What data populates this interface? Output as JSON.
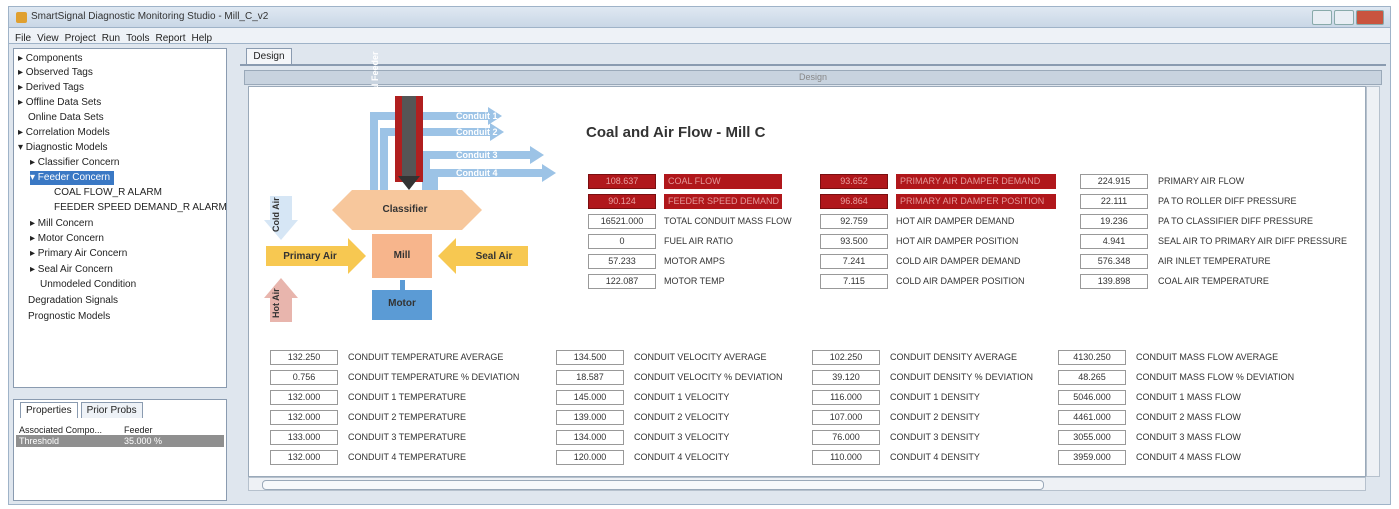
{
  "window": {
    "title": "SmartSignal Diagnostic Monitoring Studio - Mill_C_v2"
  },
  "menu": [
    "File",
    "View",
    "Project",
    "Run",
    "Tools",
    "Report",
    "Help"
  ],
  "tree": {
    "items": [
      {
        "label": "▸ Components"
      },
      {
        "label": "▸ Observed Tags"
      },
      {
        "label": "▸ Derived Tags"
      },
      {
        "label": "▸ Offline Data Sets"
      },
      {
        "label": "Online Data Sets"
      },
      {
        "label": "▸ Correlation Models"
      },
      {
        "label": "▾ Diagnostic Models"
      },
      {
        "label": "▸ Classifier Concern"
      },
      {
        "label": "▾ Feeder Concern"
      },
      {
        "label": "COAL FLOW_R ALARM"
      },
      {
        "label": "FEEDER SPEED DEMAND_R ALARM"
      },
      {
        "label": "▸ Mill Concern"
      },
      {
        "label": "▸ Motor Concern"
      },
      {
        "label": "▸ Primary Air Concern"
      },
      {
        "label": "▸ Seal Air Concern"
      },
      {
        "label": "Unmodeled Condition"
      },
      {
        "label": "Degradation Signals"
      },
      {
        "label": "Prognostic Models"
      }
    ]
  },
  "properties": {
    "tabs": [
      "Properties",
      "Prior Probs"
    ],
    "rows": [
      {
        "key": "Associated Compo...",
        "value": "Feeder"
      },
      {
        "key": "Threshold",
        "value": "35.000 %"
      }
    ]
  },
  "design": {
    "tab_label": "Design",
    "inner_title": "Design",
    "heading": "Coal and Air Flow - Mill C",
    "diagram": {
      "conduits": [
        "Conduit 1",
        "Conduit 2",
        "Conduit 3",
        "Conduit 4"
      ],
      "coal_feeder": "Coal Feeder",
      "classifier": "Classifier",
      "mill": "Mill",
      "motor": "Motor",
      "primary_air": "Primary Air",
      "seal_air": "Seal Air",
      "cold_air": "Cold Air",
      "hot_air": "Hot Air"
    },
    "top_col1": [
      {
        "value": "108.637",
        "label": "COAL FLOW",
        "alarm": true
      },
      {
        "value": "90.124",
        "label": "FEEDER SPEED DEMAND",
        "alarm": true
      },
      {
        "value": "16521.000",
        "label": "TOTAL CONDUIT MASS FLOW",
        "alarm": false
      },
      {
        "value": "0",
        "label": "FUEL AIR RATIO",
        "alarm": false
      },
      {
        "value": "57.233",
        "label": "MOTOR AMPS",
        "alarm": false
      },
      {
        "value": "122.087",
        "label": "MOTOR TEMP",
        "alarm": false
      }
    ],
    "top_col2": [
      {
        "value": "93.652",
        "label": "PRIMARY AIR DAMPER DEMAND",
        "alarm": true
      },
      {
        "value": "96.864",
        "label": "PRIMARY AIR DAMPER POSITION",
        "alarm": true
      },
      {
        "value": "92.759",
        "label": "HOT AIR DAMPER DEMAND",
        "alarm": false
      },
      {
        "value": "93.500",
        "label": "HOT AIR DAMPER POSITION",
        "alarm": false
      },
      {
        "value": "7.241",
        "label": "COLD AIR DAMPER DEMAND",
        "alarm": false
      },
      {
        "value": "7.115",
        "label": "COLD AIR DAMPER POSITION",
        "alarm": false
      }
    ],
    "top_col3": [
      {
        "value": "224.915",
        "label": "PRIMARY AIR FLOW"
      },
      {
        "value": "22.111",
        "label": "PA TO ROLLER DIFF PRESSURE"
      },
      {
        "value": "19.236",
        "label": "PA TO CLASSIFIER DIFF PRESSURE"
      },
      {
        "value": "4.941",
        "label": "SEAL AIR TO PRIMARY AIR DIFF PRESSURE"
      },
      {
        "value": "576.348",
        "label": "AIR INLET TEMPERATURE"
      },
      {
        "value": "139.898",
        "label": "COAL AIR TEMPERATURE"
      }
    ],
    "bottom_col1": [
      {
        "value": "132.250",
        "label": "CONDUIT TEMPERATURE AVERAGE"
      },
      {
        "value": "0.756",
        "label": "CONDUIT TEMPERATURE % DEVIATION"
      },
      {
        "value": "132.000",
        "label": "CONDUIT 1 TEMPERATURE"
      },
      {
        "value": "132.000",
        "label": "CONDUIT 2 TEMPERATURE"
      },
      {
        "value": "133.000",
        "label": "CONDUIT 3 TEMPERATURE"
      },
      {
        "value": "132.000",
        "label": "CONDUIT 4 TEMPERATURE"
      }
    ],
    "bottom_col2": [
      {
        "value": "134.500",
        "label": "CONDUIT VELOCITY AVERAGE"
      },
      {
        "value": "18.587",
        "label": "CONDUIT VELOCITY % DEVIATION"
      },
      {
        "value": "145.000",
        "label": "CONDUIT 1 VELOCITY"
      },
      {
        "value": "139.000",
        "label": "CONDUIT 2 VELOCITY"
      },
      {
        "value": "134.000",
        "label": "CONDUIT 3 VELOCITY"
      },
      {
        "value": "120.000",
        "label": "CONDUIT 4 VELOCITY"
      }
    ],
    "bottom_col3": [
      {
        "value": "102.250",
        "label": "CONDUIT DENSITY AVERAGE"
      },
      {
        "value": "39.120",
        "label": "CONDUIT DENSITY % DEVIATION"
      },
      {
        "value": "116.000",
        "label": "CONDUIT 1 DENSITY"
      },
      {
        "value": "107.000",
        "label": "CONDUIT 2 DENSITY"
      },
      {
        "value": "76.000",
        "label": "CONDUIT 3 DENSITY"
      },
      {
        "value": "110.000",
        "label": "CONDUIT 4 DENSITY"
      }
    ],
    "bottom_col4": [
      {
        "value": "4130.250",
        "label": "CONDUIT MASS FLOW AVERAGE"
      },
      {
        "value": "48.265",
        "label": "CONDUIT MASS FLOW % DEVIATION"
      },
      {
        "value": "5046.000",
        "label": "CONDUIT 1 MASS FLOW"
      },
      {
        "value": "4461.000",
        "label": "CONDUIT 2 MASS FLOW"
      },
      {
        "value": "3055.000",
        "label": "CONDUIT 3 MASS FLOW"
      },
      {
        "value": "3959.000",
        "label": "CONDUIT 4 MASS FLOW"
      }
    ]
  },
  "colors": {
    "alarm": "#b0171b",
    "selection": "#3a78c4",
    "classifier": "#f7c79c",
    "mill": "#f7b58c",
    "air_arrow": "#f7c851",
    "conduit": "#9cc3e6",
    "motor": "#5b9bd5"
  }
}
